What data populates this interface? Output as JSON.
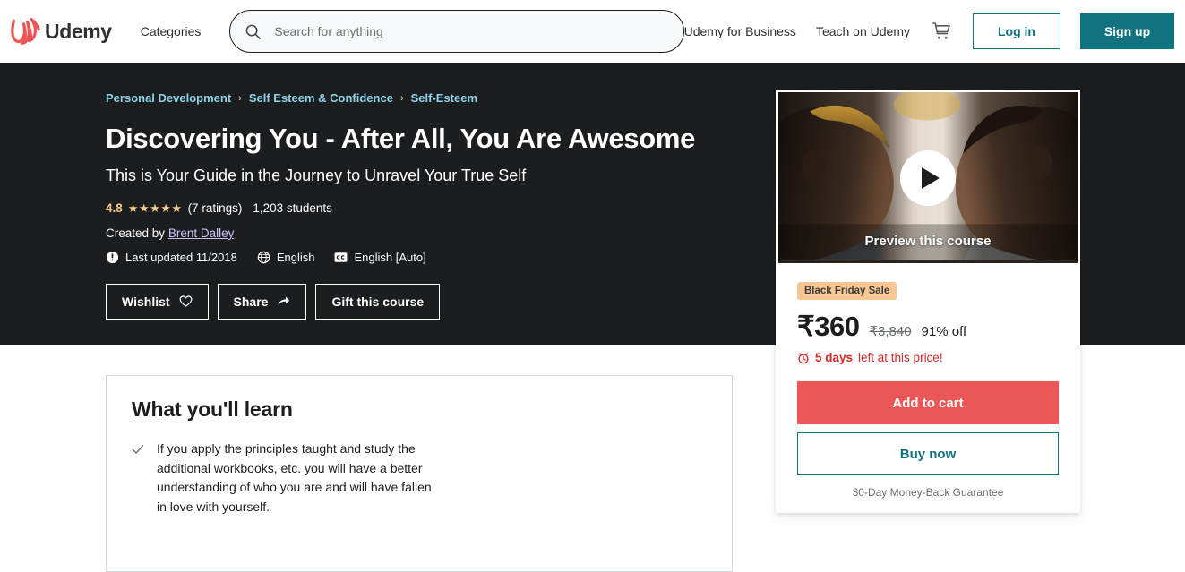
{
  "header": {
    "logo_text": "Udemy",
    "logo_icon": "udemy-u-logo-icon",
    "categories_label": "Categories",
    "search": {
      "placeholder": "Search for anything",
      "value": "",
      "icon": "search-icon"
    },
    "business_label": "Udemy for Business",
    "teach_label": "Teach on Udemy",
    "cart_icon": "shopping-cart-icon",
    "login_label": "Log in",
    "signup_label": "Sign up",
    "accent_teal": "#11737F",
    "logo_red": "#EB5757"
  },
  "hero": {
    "background_color": "#1C1D1F",
    "breadcrumb": [
      "Personal Development",
      "Self Esteem & Confidence",
      "Self-Esteem"
    ],
    "breadcrumb_separator": "›",
    "breadcrumb_color": "#8ED5EA",
    "title": "Discovering You - After All, You Are Awesome",
    "subtitle": "This is Your Guide in the Journey to Unravel Your True Self",
    "rating": {
      "score": "4.8",
      "stars": "★★★★★",
      "star_color": "#F3CA8C",
      "count_label": "(7 ratings)",
      "students_label": "1,203 students"
    },
    "creator_prefix": "Created by",
    "creator_name": "Brent Dalley",
    "meta": [
      {
        "icon": "exclamation-circle-icon",
        "label": "Last updated 11/2018"
      },
      {
        "icon": "globe-icon",
        "label": "English"
      },
      {
        "icon": "closed-caption-icon",
        "label": "English [Auto]"
      }
    ],
    "actions": [
      {
        "label": "Wishlist",
        "icon": "heart-icon"
      },
      {
        "label": "Share",
        "icon": "share-arrow-icon"
      },
      {
        "label": "Gift this course",
        "icon": ""
      }
    ]
  },
  "sidebar": {
    "preview": {
      "label": "Preview this course",
      "play_icon": "play-triangle-icon",
      "alt": "Two men facing each other in profile against a bright background"
    },
    "sale_badge": "Black Friday Sale",
    "sale_badge_color": "#F7C693",
    "price_current": "₹360",
    "price_original": "₹3,840",
    "discount": "91% off",
    "timer_icon": "alarm-clock-icon",
    "timer_strong": "5 days",
    "timer_rest": "left at this price!",
    "timer_color": "#D32B2B",
    "add_to_cart_label": "Add to cart",
    "add_to_cart_color": "#EB5757",
    "buy_now_label": "Buy now",
    "guarantee_label": "30-Day Money-Back Guarantee"
  },
  "learn": {
    "title": "What you'll learn",
    "items": [
      {
        "icon": "check-icon",
        "text": "If you apply the principles taught and study the additional workbooks, etc. you will have a better understanding of who you are and will have fallen in love with yourself."
      }
    ]
  }
}
